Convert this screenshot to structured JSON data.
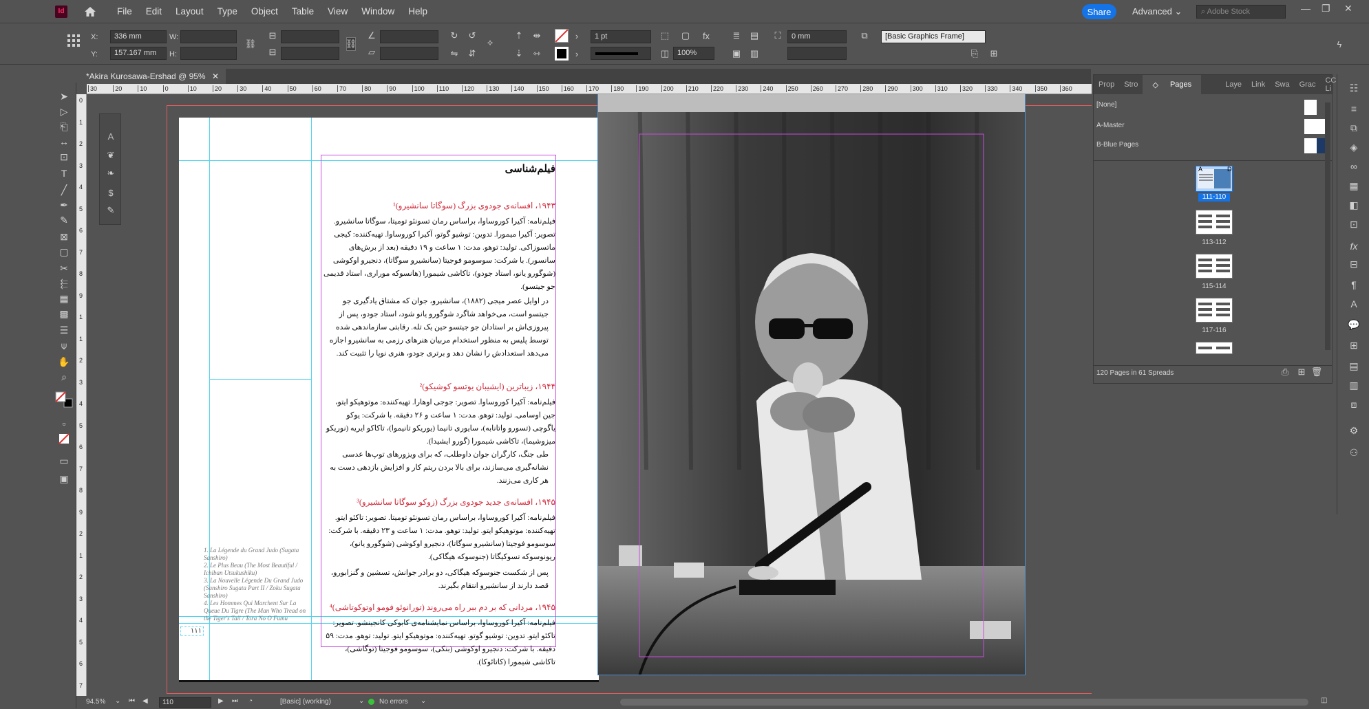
{
  "app": {
    "icon_label": "Id"
  },
  "menu": [
    "File",
    "Edit",
    "Layout",
    "Type",
    "Object",
    "Table",
    "View",
    "Window",
    "Help"
  ],
  "share_label": "Share",
  "workspace_label": "Advanced",
  "stock_placeholder": "Adobe Stock",
  "control": {
    "x_label": "X:",
    "x_value": "336 mm",
    "y_label": "Y:",
    "y_value": "157.167 mm",
    "w_label": "W:",
    "h_label": "H:",
    "stroke_weight": "1 pt",
    "scale": "100%",
    "offset": "0 mm",
    "object_style": "[Basic Graphics Frame]"
  },
  "document_tab": "*Akira Kurosawa-Ershad @ 95%",
  "ruler_h": [
    "30",
    "20",
    "10",
    "0",
    "10",
    "20",
    "30",
    "40",
    "50",
    "60",
    "70",
    "80",
    "90",
    "100",
    "110",
    "120",
    "130",
    "140",
    "150",
    "160",
    "170",
    "180",
    "190",
    "200",
    "210",
    "220",
    "230",
    "240",
    "250",
    "260",
    "270",
    "280",
    "290",
    "300",
    "310",
    "320",
    "330",
    "340",
    "350",
    "360"
  ],
  "ruler_v": [
    "0",
    "1",
    "2",
    "3",
    "4",
    "5",
    "6",
    "7",
    "8",
    "9",
    "1",
    "1",
    "2",
    "3",
    "4",
    "5",
    "6",
    "7",
    "8",
    "9",
    "2",
    "1",
    "2",
    "3",
    "4",
    "5",
    "6",
    "7"
  ],
  "page_content": {
    "heading": "فیلم‌شناسی",
    "entries": [
      {
        "title": "۱۹۴۳، افسانه‌ی جودوی بزرگ (سوگاتا سانشیرو)¹",
        "credits": "فیلم‌نامه: آکیرا کوروساوا، براساس رمان تسونئو تومیتا، سوگاتا سانشیرو. تصویر: آکیرا میمورا. تدوین: توشیو گوتو، آکیرا کوروساوا. تهیه‌کننده: کیجی ماتسوزاکی. تولید: توهو. مدت: ۱ ساعت و ۱۹ دقیقه (بعد از برش‌های سانسور). با شرکت: سوسومو فوجیتا (سانشیرو سوگاتا)، دنجیرو اوکوشی (شوگورو یانو، استاد جودو)، تاکاشی شیمورا (هانسوکه موراری، استاد قدیمی جو جیتسو).",
        "synopsis": "در اوایل عصر میجی (۱۸۸۲)، سانشیرو، جوان که مشتاق یادگیری جو جیتسو است، می‌خواهد شاگرد شوگورو یانو شود، استاد جودو، پس از پیروزی‌اش بر استادان جو جیتسو حین یک تله. رقابتی سازماندهی شده توسط پلیس به منظور استخدام مربیان هنرهای رزمی به سانشیرو اجازه می‌دهد استعدادش را نشان دهد و برتری جودو، هنری نوپا را تثبیت کند."
      },
      {
        "title": "۱۹۴۴، زیباترین (ایشیبان یوتسو کوشیکو)²",
        "credits": "فیلم‌نامه: آکیرا کوروساوا. تصویر: جوجی اوهارا. تهیه‌کننده: موتوهیکو ایتو، جین اوسامی. تولید: توهو. مدت: ۱ ساعت و ۲۶ دقیقه. با شرکت: یوکو یاگوچی (تسورو واتانابه)، سایوری تانیما (یوریکو تانیموا)، تاکاکو ایریه (نوریکو میزوشیما)، تاکاشی شیمورا (گورو ایشیدا).",
        "synopsis": "طی جنگ، کارگران جوان داوطلب، که برای ویزورهای توپ‌ها عدسی نشانه‌گیری می‌سازند، برای بالا بردن ریتم کار و افزایش بازدهی دست به هر کاری می‌زنند."
      },
      {
        "title": "۱۹۴۵، افسانه‌ی جدید جودوی بزرگ (زوکو سوگاتا سانشیرو)³",
        "credits": "فیلم‌نامه: آکیرا کوروساوا، براساس رمان تسونئو تومیتا. تصویر: تاکئو ایتو. تهیه‌کننده: موتوهیکو ایتو. تولید: توهو. مدت: ۱ ساعت و ۲۳ دقیقه. با شرکت: سوسومو فوجیتا (سانشیرو سوگاتا)، دنجیرو اوکوشی (شوگورو یانو)، ریونوسوکه تسوکیگاتا (جنوسوکه هیگاکی).",
        "synopsis": "پس از شکست جنوسوکه هیگاکی، دو برادر جوانش، تسشین و گنزابورو، قصد دارند از سانشیرو انتقام بگیرند."
      },
      {
        "title": "۱۹۴۵، مردانی که بر دم ببر راه می‌روند (تورانوئو فومو اوتوکوتاشی)⁴",
        "credits": "فیلم‌نامه: آکیرا کوروساوا، براساس نمایشنامه‌ی کابوکی کانجینشو. تصویر: تاکئو ایتو. تدوین: توشیو گوتو. تهیه‌کننده: موتوهیکو ایتو. تولید: توهو. مدت: ۵۹ دقیقه. با شرکت: دنجیرو اوکوشی (بنکی)، سوسومو فوجیتا (توگاشی)، تاکاشی شیمورا (کاتائوکا)."
      }
    ],
    "footnotes": [
      "1. La Légende du Grand Judo (Sugata Sanshiro)",
      "2. Le Plus Beau (The Most Beautiful / Ichiban Utsukushiku)",
      "3. La Nouvelle Légende Du Grand Judo (Sanshiro Sugata Part II / Zoku Sugata Sanshiro)",
      "4. Les Hommes Qui Marchent Sur La Queue Du Tigre (The Man Who Tread on the Tiger's Tail / Tora No O Fumu Otokotachi)"
    ],
    "page_number": "۱۱۱"
  },
  "panel": {
    "tabs": [
      "Prop",
      "Stro",
      "Pages",
      "Laye",
      "Link",
      "Swa",
      "Grac",
      "CC Li"
    ],
    "active_tab": "Pages",
    "masters": [
      "[None]",
      "A-Master",
      "B-Blue Pages"
    ],
    "spreads": [
      {
        "label": "111-110",
        "selected": true,
        "prefix": "A",
        "suffix": "D"
      },
      {
        "label": "113-112",
        "selected": false,
        "prefix": "A",
        "suffix": "A"
      },
      {
        "label": "115-114",
        "selected": false,
        "prefix": "A",
        "suffix": "A"
      },
      {
        "label": "117-116",
        "selected": false,
        "prefix": "A",
        "suffix": "A"
      },
      {
        "label": "",
        "selected": false,
        "prefix": "A",
        "suffix": "A"
      }
    ],
    "summary": "120 Pages in 61 Spreads"
  },
  "status": {
    "zoom": "94.5%",
    "page": "110",
    "style": "[Basic] (working)",
    "errors": "No errors"
  }
}
